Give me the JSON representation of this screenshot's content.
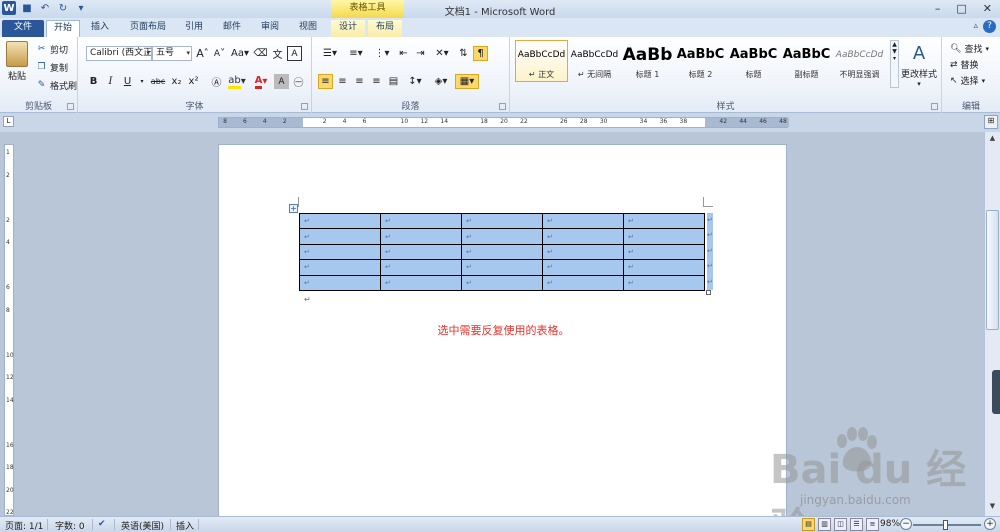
{
  "window": {
    "title": "文档1 - Microsoft Word",
    "context_title": "表格工具",
    "controls": [
      "–",
      "□",
      "✕"
    ]
  },
  "tabs": [
    {
      "label": "文件",
      "kind": "file"
    },
    {
      "label": "开始",
      "kind": "active"
    },
    {
      "label": "插入",
      "kind": ""
    },
    {
      "label": "页面布局",
      "kind": ""
    },
    {
      "label": "引用",
      "kind": ""
    },
    {
      "label": "邮件",
      "kind": ""
    },
    {
      "label": "审阅",
      "kind": ""
    },
    {
      "label": "视图",
      "kind": ""
    },
    {
      "label": "设计",
      "kind": "ctx"
    },
    {
      "label": "布局",
      "kind": "ctx"
    }
  ],
  "ribbon": {
    "clipboard": {
      "label": "剪贴板",
      "paste": "粘贴",
      "cut": "剪切",
      "copy": "复制",
      "format_painter": "格式刷"
    },
    "font": {
      "label": "字体",
      "font_name": "Calibri (西文正",
      "font_size": "五号",
      "grow": "A",
      "shrink": "A",
      "case": "Aa",
      "bold": "B",
      "italic": "I",
      "underline": "U",
      "strike": "abc",
      "sub": "x₂",
      "sup": "x²"
    },
    "paragraph": {
      "label": "段落"
    },
    "styles": {
      "label": "样式",
      "items": [
        {
          "preview": "AaBbCcDd",
          "name": "↵ 正文",
          "selected": true,
          "size": "9px",
          "weight": "normal",
          "italic": false
        },
        {
          "preview": "AaBbCcDd",
          "name": "↵ 无间隔",
          "selected": false,
          "size": "9px",
          "weight": "normal",
          "italic": false
        },
        {
          "preview": "AaBb",
          "name": "标题 1",
          "selected": false,
          "size": "17px",
          "weight": "bold",
          "italic": false
        },
        {
          "preview": "AaBbC",
          "name": "标题 2",
          "selected": false,
          "size": "13px",
          "weight": "bold",
          "italic": false
        },
        {
          "preview": "AaBbC",
          "name": "标题",
          "selected": false,
          "size": "13px",
          "weight": "bold",
          "italic": false
        },
        {
          "preview": "AaBbC",
          "name": "副标题",
          "selected": false,
          "size": "13px",
          "weight": "bold",
          "italic": false
        },
        {
          "preview": "AaBbCcDd",
          "name": "不明显强调",
          "selected": false,
          "size": "9px",
          "weight": "normal",
          "italic": true
        }
      ],
      "change_styles": "更改样式"
    },
    "editing": {
      "label": "编辑",
      "find": "查找",
      "replace": "替换",
      "select": "选择"
    }
  },
  "ruler": {
    "ticks": [
      "8",
      "6",
      "4",
      "2",
      "",
      "2",
      "4",
      "6",
      "",
      "10",
      "12",
      "14",
      "",
      "18",
      "20",
      "22",
      "",
      "26",
      "28",
      "30",
      "",
      "34",
      "36",
      "38",
      "",
      "42",
      "44",
      "46",
      "48"
    ]
  },
  "vruler": {
    "ticks": [
      "1",
      "2",
      "",
      "2",
      "4",
      "",
      "6",
      "8",
      "",
      "10",
      "12",
      "14",
      "",
      "16",
      "18",
      "20",
      "22"
    ]
  },
  "document": {
    "rows": 5,
    "cols": 5,
    "cell_mark": "↵",
    "caption": "选中需要反复使用的表格。"
  },
  "status": {
    "page": "页面: 1/1",
    "words": "字数: 0",
    "language": "英语(美国)",
    "mode": "插入",
    "zoom": "98%",
    "zoom_percent": 98
  },
  "watermark": {
    "main": "Bai du 经验",
    "sub": "jingyan.baidu.com"
  },
  "colors": {
    "brand": "#2b579a",
    "table_select": "#a6c8ee",
    "caption": "#e8302a"
  }
}
